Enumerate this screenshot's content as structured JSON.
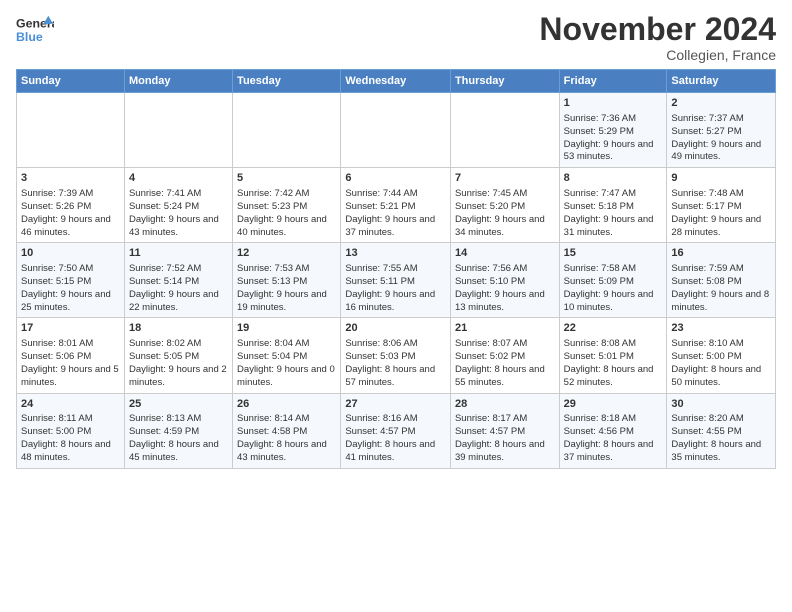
{
  "header": {
    "logo_line1": "General",
    "logo_line2": "Blue",
    "month_year": "November 2024",
    "location": "Collegien, France"
  },
  "weekdays": [
    "Sunday",
    "Monday",
    "Tuesday",
    "Wednesday",
    "Thursday",
    "Friday",
    "Saturday"
  ],
  "weeks": [
    [
      {
        "day": "",
        "info": ""
      },
      {
        "day": "",
        "info": ""
      },
      {
        "day": "",
        "info": ""
      },
      {
        "day": "",
        "info": ""
      },
      {
        "day": "",
        "info": ""
      },
      {
        "day": "1",
        "info": "Sunrise: 7:36 AM\nSunset: 5:29 PM\nDaylight: 9 hours and 53 minutes."
      },
      {
        "day": "2",
        "info": "Sunrise: 7:37 AM\nSunset: 5:27 PM\nDaylight: 9 hours and 49 minutes."
      }
    ],
    [
      {
        "day": "3",
        "info": "Sunrise: 7:39 AM\nSunset: 5:26 PM\nDaylight: 9 hours and 46 minutes."
      },
      {
        "day": "4",
        "info": "Sunrise: 7:41 AM\nSunset: 5:24 PM\nDaylight: 9 hours and 43 minutes."
      },
      {
        "day": "5",
        "info": "Sunrise: 7:42 AM\nSunset: 5:23 PM\nDaylight: 9 hours and 40 minutes."
      },
      {
        "day": "6",
        "info": "Sunrise: 7:44 AM\nSunset: 5:21 PM\nDaylight: 9 hours and 37 minutes."
      },
      {
        "day": "7",
        "info": "Sunrise: 7:45 AM\nSunset: 5:20 PM\nDaylight: 9 hours and 34 minutes."
      },
      {
        "day": "8",
        "info": "Sunrise: 7:47 AM\nSunset: 5:18 PM\nDaylight: 9 hours and 31 minutes."
      },
      {
        "day": "9",
        "info": "Sunrise: 7:48 AM\nSunset: 5:17 PM\nDaylight: 9 hours and 28 minutes."
      }
    ],
    [
      {
        "day": "10",
        "info": "Sunrise: 7:50 AM\nSunset: 5:15 PM\nDaylight: 9 hours and 25 minutes."
      },
      {
        "day": "11",
        "info": "Sunrise: 7:52 AM\nSunset: 5:14 PM\nDaylight: 9 hours and 22 minutes."
      },
      {
        "day": "12",
        "info": "Sunrise: 7:53 AM\nSunset: 5:13 PM\nDaylight: 9 hours and 19 minutes."
      },
      {
        "day": "13",
        "info": "Sunrise: 7:55 AM\nSunset: 5:11 PM\nDaylight: 9 hours and 16 minutes."
      },
      {
        "day": "14",
        "info": "Sunrise: 7:56 AM\nSunset: 5:10 PM\nDaylight: 9 hours and 13 minutes."
      },
      {
        "day": "15",
        "info": "Sunrise: 7:58 AM\nSunset: 5:09 PM\nDaylight: 9 hours and 10 minutes."
      },
      {
        "day": "16",
        "info": "Sunrise: 7:59 AM\nSunset: 5:08 PM\nDaylight: 9 hours and 8 minutes."
      }
    ],
    [
      {
        "day": "17",
        "info": "Sunrise: 8:01 AM\nSunset: 5:06 PM\nDaylight: 9 hours and 5 minutes."
      },
      {
        "day": "18",
        "info": "Sunrise: 8:02 AM\nSunset: 5:05 PM\nDaylight: 9 hours and 2 minutes."
      },
      {
        "day": "19",
        "info": "Sunrise: 8:04 AM\nSunset: 5:04 PM\nDaylight: 9 hours and 0 minutes."
      },
      {
        "day": "20",
        "info": "Sunrise: 8:06 AM\nSunset: 5:03 PM\nDaylight: 8 hours and 57 minutes."
      },
      {
        "day": "21",
        "info": "Sunrise: 8:07 AM\nSunset: 5:02 PM\nDaylight: 8 hours and 55 minutes."
      },
      {
        "day": "22",
        "info": "Sunrise: 8:08 AM\nSunset: 5:01 PM\nDaylight: 8 hours and 52 minutes."
      },
      {
        "day": "23",
        "info": "Sunrise: 8:10 AM\nSunset: 5:00 PM\nDaylight: 8 hours and 50 minutes."
      }
    ],
    [
      {
        "day": "24",
        "info": "Sunrise: 8:11 AM\nSunset: 5:00 PM\nDaylight: 8 hours and 48 minutes."
      },
      {
        "day": "25",
        "info": "Sunrise: 8:13 AM\nSunset: 4:59 PM\nDaylight: 8 hours and 45 minutes."
      },
      {
        "day": "26",
        "info": "Sunrise: 8:14 AM\nSunset: 4:58 PM\nDaylight: 8 hours and 43 minutes."
      },
      {
        "day": "27",
        "info": "Sunrise: 8:16 AM\nSunset: 4:57 PM\nDaylight: 8 hours and 41 minutes."
      },
      {
        "day": "28",
        "info": "Sunrise: 8:17 AM\nSunset: 4:57 PM\nDaylight: 8 hours and 39 minutes."
      },
      {
        "day": "29",
        "info": "Sunrise: 8:18 AM\nSunset: 4:56 PM\nDaylight: 8 hours and 37 minutes."
      },
      {
        "day": "30",
        "info": "Sunrise: 8:20 AM\nSunset: 4:55 PM\nDaylight: 8 hours and 35 minutes."
      }
    ]
  ]
}
